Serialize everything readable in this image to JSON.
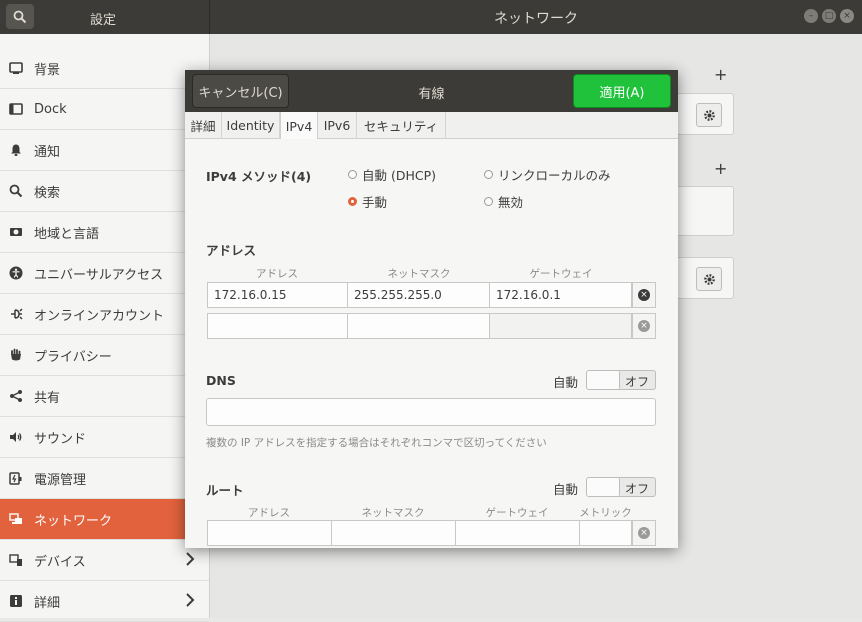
{
  "titlebar": {
    "app_title": "設定",
    "page_title": "ネットワーク"
  },
  "sidebar": {
    "items": [
      {
        "label": "背景",
        "icon": "background-icon"
      },
      {
        "label": "Dock",
        "icon": "dock-icon"
      },
      {
        "label": "通知",
        "icon": "bell-icon"
      },
      {
        "label": "検索",
        "icon": "search-icon"
      },
      {
        "label": "地域と言語",
        "icon": "region-icon"
      },
      {
        "label": "ユニバーサルアクセス",
        "icon": "accessibility-icon"
      },
      {
        "label": "オンラインアカウント",
        "icon": "online-accounts-icon"
      },
      {
        "label": "プライバシー",
        "icon": "privacy-hand-icon"
      },
      {
        "label": "共有",
        "icon": "share-icon"
      },
      {
        "label": "サウンド",
        "icon": "speaker-icon"
      },
      {
        "label": "電源管理",
        "icon": "power-icon"
      },
      {
        "label": "ネットワーク",
        "icon": "network-icon",
        "active": true
      },
      {
        "label": "デバイス",
        "icon": "devices-icon",
        "chevron": true
      },
      {
        "label": "詳細",
        "icon": "info-icon",
        "chevron": true
      }
    ]
  },
  "dialog": {
    "title": "有線",
    "cancel_label": "キャンセル(C)",
    "apply_label": "適用(A)",
    "tabs": [
      "詳細",
      "Identity",
      "IPv4",
      "IPv6",
      "セキュリティ"
    ],
    "active_tab": "IPv4",
    "method": {
      "label": "IPv4 メソッド(4)",
      "options": [
        "自動 (DHCP)",
        "リンクローカルのみ",
        "手動",
        "無効"
      ],
      "selected": "手動"
    },
    "address": {
      "heading": "アドレス",
      "columns": [
        "アドレス",
        "ネットマスク",
        "ゲートウェイ"
      ],
      "rows": [
        [
          "172.16.0.15",
          "255.255.255.0",
          "172.16.0.1"
        ],
        [
          "",
          "",
          ""
        ]
      ]
    },
    "dns": {
      "heading": "DNS",
      "auto_label": "自動",
      "toggle_state": "オフ",
      "value": "",
      "hint": "複数の IP アドレスを指定する場合はそれぞれコンマで区切ってください"
    },
    "routes": {
      "heading": "ルート",
      "auto_label": "自動",
      "toggle_state": "オフ",
      "columns": [
        "アドレス",
        "ネットマスク",
        "ゲートウェイ",
        "メトリック"
      ]
    }
  },
  "colors": {
    "accent": "#e2623d",
    "apply_green": "#1fc23a",
    "titlebar": "#3c3b37"
  }
}
